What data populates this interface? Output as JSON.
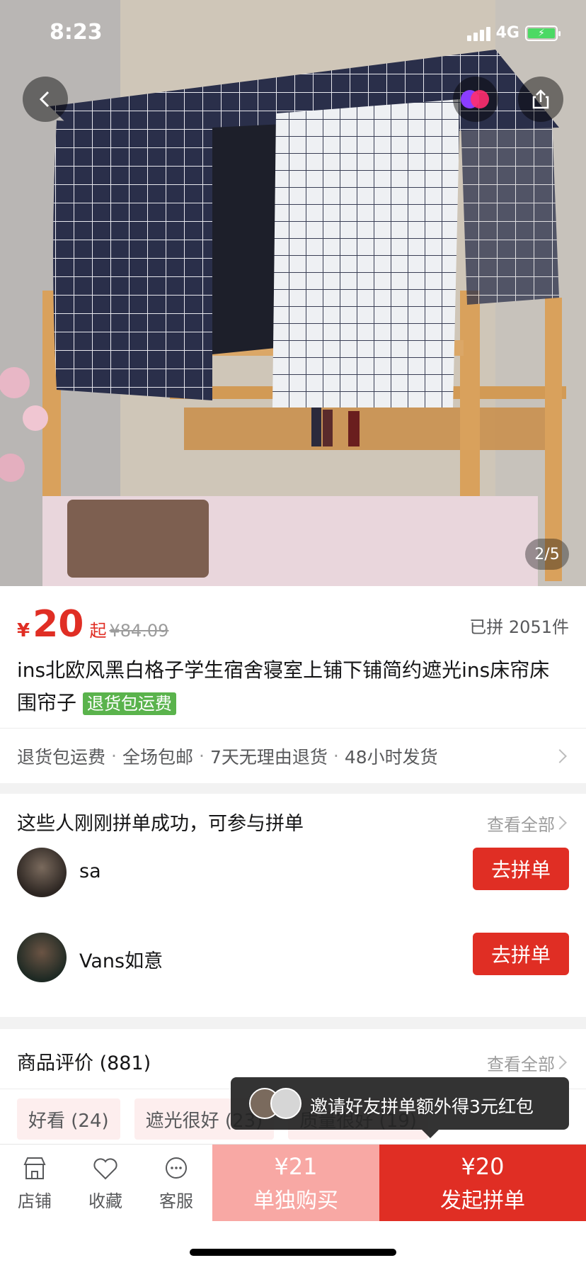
{
  "status_bar": {
    "time": "8:23",
    "network": "4G"
  },
  "gallery": {
    "counter": "2/5"
  },
  "product": {
    "currency": "¥",
    "price": "20",
    "price_suffix": "起",
    "original_price": "¥84.09",
    "sold": "已拼 2051件",
    "title": "ins北欧风黑白格子学生宿舍寝室上铺下铺简约遮光ins床帘床围帘子",
    "title_tag": "退货包运费",
    "services": [
      "退货包运费",
      "全场包邮",
      "7天无理由退货",
      "48小时发货"
    ]
  },
  "group_buy": {
    "heading": "这些人刚刚拼单成功，可参与拼单",
    "see_all": "查看全部",
    "users": [
      {
        "name": "sa",
        "button": "去拼单"
      },
      {
        "name": "Vans如意",
        "button": "去拼单"
      }
    ]
  },
  "reviews": {
    "heading": "商品评价 (881)",
    "see_all": "查看全部",
    "tags": [
      "好看 (24)",
      "遮光很好 (23)",
      "质量很好 (19)"
    ]
  },
  "toast": {
    "text": "邀请好友拼单额外得3元红包"
  },
  "bottom_bar": {
    "store": "店铺",
    "favorite": "收藏",
    "service": "客服",
    "single_price": "¥21",
    "single_label": "单独购买",
    "group_price": "¥20",
    "group_label": "发起拼单"
  },
  "colors": {
    "accent": "#e02e24",
    "accent_light": "#f8a8a4",
    "tag_green": "#5ab34c"
  }
}
